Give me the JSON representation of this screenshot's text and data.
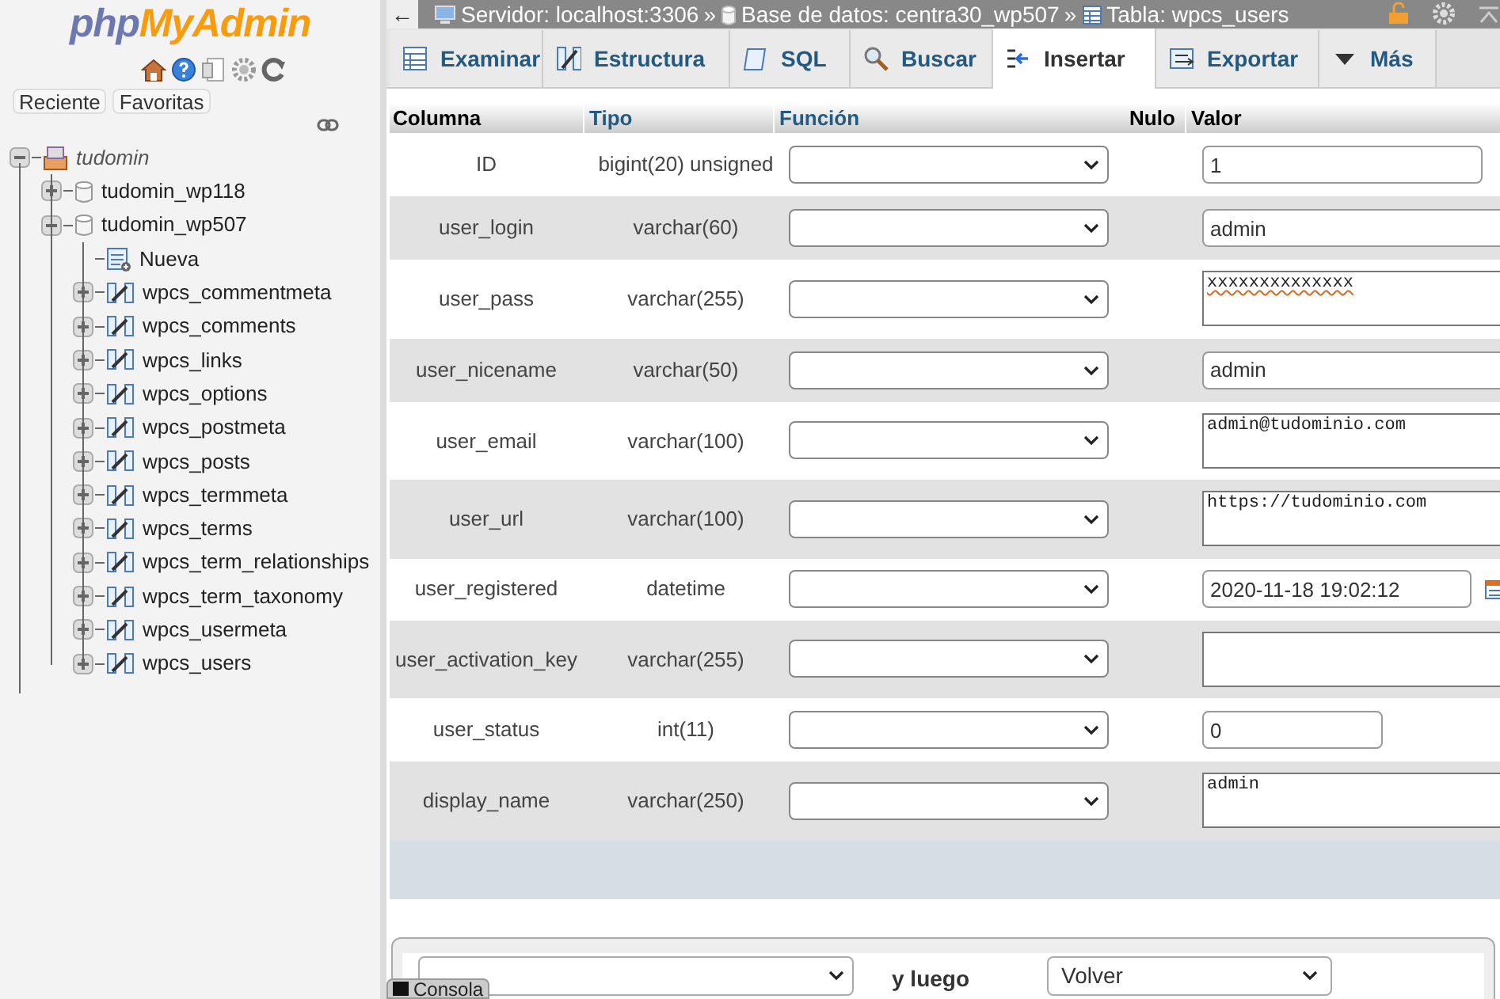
{
  "sidebar": {
    "logo": [
      "php",
      "MyAdmin"
    ],
    "buttons": [
      {
        "label": "Reciente"
      },
      {
        "label": "Favoritas"
      }
    ],
    "tree": {
      "label": "tudomin",
      "expanded": true,
      "kind": "group",
      "children": [
        {
          "label": "tudomin_wp118",
          "kind": "db",
          "expanded": false
        },
        {
          "label": "tudomin_wp507",
          "kind": "db",
          "expanded": true,
          "children": [
            {
              "label": "Nueva",
              "kind": "new"
            },
            {
              "label": "wpcs_commentmeta",
              "kind": "table",
              "expanded": false
            },
            {
              "label": "wpcs_comments",
              "kind": "table",
              "expanded": false
            },
            {
              "label": "wpcs_links",
              "kind": "table",
              "expanded": false
            },
            {
              "label": "wpcs_options",
              "kind": "table",
              "expanded": false
            },
            {
              "label": "wpcs_postmeta",
              "kind": "table",
              "expanded": false
            },
            {
              "label": "wpcs_posts",
              "kind": "table",
              "expanded": false
            },
            {
              "label": "wpcs_termmeta",
              "kind": "table",
              "expanded": false
            },
            {
              "label": "wpcs_terms",
              "kind": "table",
              "expanded": false
            },
            {
              "label": "wpcs_term_relationships",
              "kind": "table",
              "expanded": false
            },
            {
              "label": "wpcs_term_taxonomy",
              "kind": "table",
              "expanded": false
            },
            {
              "label": "wpcs_usermeta",
              "kind": "table",
              "expanded": false
            },
            {
              "label": "wpcs_users",
              "kind": "table",
              "expanded": false
            }
          ]
        }
      ]
    }
  },
  "breadcrumb": {
    "separator": "»",
    "items": [
      {
        "kind": "server",
        "label": "Servidor: localhost:3306"
      },
      {
        "kind": "db",
        "label": "Base de datos: centra30_wp507"
      },
      {
        "kind": "table",
        "label": "Tabla: wpcs_users"
      }
    ]
  },
  "tabs": [
    {
      "kind": "browse",
      "label": "Examinar",
      "selected": false
    },
    {
      "kind": "structure",
      "label": "Estructura",
      "selected": false
    },
    {
      "kind": "sql",
      "label": "SQL",
      "selected": false
    },
    {
      "kind": "search",
      "label": "Buscar",
      "selected": false
    },
    {
      "kind": "insert",
      "label": "Insertar",
      "selected": true
    },
    {
      "kind": "export",
      "label": "Exportar",
      "selected": false
    },
    {
      "kind": "more",
      "label": "Más",
      "selected": false
    }
  ],
  "table": {
    "columns": [
      "Columna",
      "Tipo",
      "Función",
      "Nulo",
      "Valor"
    ],
    "rows": [
      {
        "column": "ID",
        "type": "bigint(20) unsigned",
        "kind": "number",
        "value": "1",
        "misspelled": false
      },
      {
        "column": "user_login",
        "type": "varchar(60)",
        "kind": "text",
        "value": "admin",
        "misspelled": false
      },
      {
        "column": "user_pass",
        "type": "varchar(255)",
        "kind": "textarea",
        "value": "xxxxxxxxxxxxxx",
        "misspelled": true
      },
      {
        "column": "user_nicename",
        "type": "varchar(50)",
        "kind": "text",
        "value": "admin",
        "misspelled": false
      },
      {
        "column": "user_email",
        "type": "varchar(100)",
        "kind": "textarea",
        "value": "admin@tudominio.com",
        "misspelled": false
      },
      {
        "column": "user_url",
        "type": "varchar(100)",
        "kind": "textarea",
        "value": "https://tudominio.com",
        "misspelled": false
      },
      {
        "column": "user_registered",
        "type": "datetime",
        "kind": "datetime",
        "value": "2020-11-18 19:02:12",
        "misspelled": false
      },
      {
        "column": "user_activation_key",
        "type": "varchar(255)",
        "kind": "textarea"
      },
      {
        "column": "user_status",
        "type": "int(11)",
        "kind": "small",
        "value": "0",
        "misspelled": false
      },
      {
        "column": "display_name",
        "type": "varchar(250)",
        "kind": "textarea",
        "value": "admin",
        "misspelled": false
      }
    ]
  },
  "footer": {
    "then_label": "y luego",
    "then_select": "Volver"
  },
  "console_tab": "Consola",
  "back_button": "←"
}
